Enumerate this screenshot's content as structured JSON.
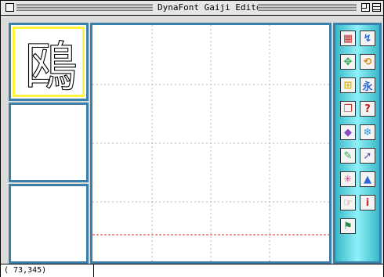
{
  "window": {
    "title": "DynaFont Gaiji Editor"
  },
  "preview": {
    "glyph_char": "鴎"
  },
  "toolbar": {
    "tools": [
      {
        "icon": "grid-edit-icon",
        "glyph": "▦",
        "color": "#c83232"
      },
      {
        "icon": "select-figure-icon",
        "glyph": "↯",
        "color": "#2a6ad8"
      },
      {
        "icon": "move-points-icon",
        "glyph": "✥",
        "color": "#2aa84a"
      },
      {
        "icon": "rotate-icon",
        "glyph": "⟲",
        "color": "#d88a1a"
      },
      {
        "icon": "add-glyph-icon",
        "glyph": "⊞",
        "color": "#e0b400"
      },
      {
        "icon": "kanji-stroke-icon",
        "glyph": "永",
        "color": "#2a6ad8"
      },
      {
        "icon": "copy-glyph-icon",
        "glyph": "❐",
        "color": "#c83232"
      },
      {
        "icon": "help-icon",
        "glyph": "?",
        "color": "#c81818"
      },
      {
        "icon": "shape-tool-icon",
        "glyph": "◆",
        "color": "#8a4ac8"
      },
      {
        "icon": "snowflake-tool-icon",
        "glyph": "❄",
        "color": "#2a98d8"
      },
      {
        "icon": "brush-icon",
        "glyph": "✎",
        "color": "#2aa84a"
      },
      {
        "icon": "arrow-tool-icon",
        "glyph": "➚",
        "color": "#6a4ab8"
      },
      {
        "icon": "transform-icon",
        "glyph": "✳",
        "color": "#d8448a"
      },
      {
        "icon": "paint-bucket-icon",
        "glyph": "▲",
        "color": "#2a6ad8"
      },
      {
        "icon": "hand-tool-icon",
        "glyph": "☞",
        "color": "#b8742a"
      },
      {
        "icon": "info-icon",
        "glyph": "i",
        "color": "#c83232"
      },
      {
        "icon": "run-icon",
        "glyph": "⚑",
        "color": "#2a8a48"
      }
    ]
  },
  "status": {
    "coordinates": "( 73,345)"
  }
}
